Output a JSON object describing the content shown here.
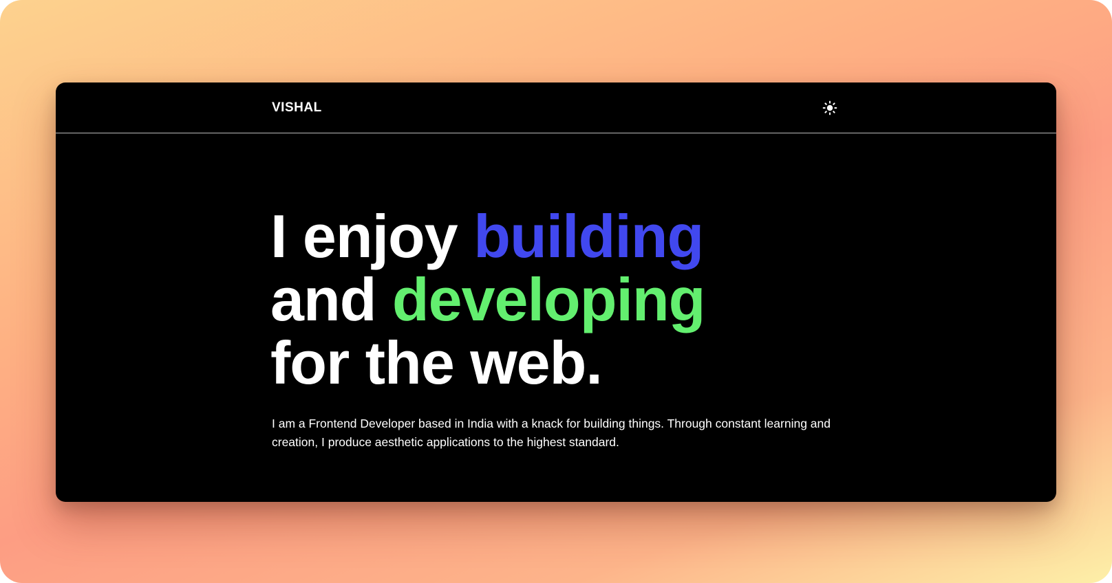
{
  "header": {
    "logo_text": "VISHAL",
    "theme_toggle_icon": "sun-icon"
  },
  "hero": {
    "line1_plain": "I enjoy ",
    "line1_accent": "building",
    "line2_plain": "and ",
    "line2_accent": "developing",
    "line3": "for the web.",
    "intro": "I am a Frontend Developer based in India with a knack for building things. Through constant learning and creation, I produce aesthetic applications to the highest standard."
  },
  "colors": {
    "background": "#000000",
    "text": "#ffffff",
    "accent_blue": "#4148ef",
    "accent_green": "#63ef6f"
  }
}
